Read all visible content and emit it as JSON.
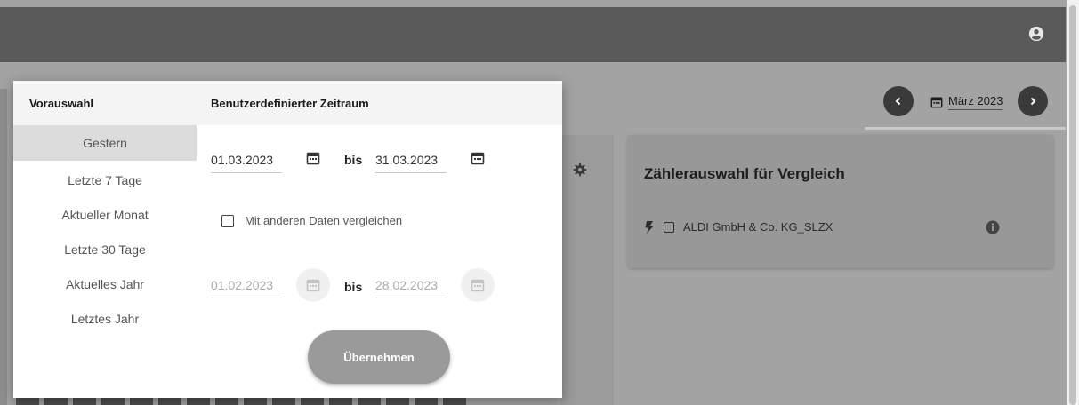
{
  "topbar": {
    "user_icon": "account-circle-icon"
  },
  "navigation": {
    "prev_icon": "chevron-left-icon",
    "next_icon": "chevron-right-icon",
    "month_label": "März 2023"
  },
  "meter_card": {
    "title": "Zählerauswahl für Vergleich",
    "items": [
      {
        "label": "ALDI GmbH & Co. KG_SLZX",
        "icon": "bolt-icon"
      }
    ]
  },
  "popup": {
    "presets_header": "Vorauswahl",
    "custom_header": "Benutzerdefinierter Zeitraum",
    "presets": [
      {
        "label": "Gestern",
        "active": true
      },
      {
        "label": "Letzte 7 Tage",
        "active": false
      },
      {
        "label": "Aktueller Monat",
        "active": false
      },
      {
        "label": "Letzte 30 Tage",
        "active": false
      },
      {
        "label": "Aktuelles Jahr",
        "active": false
      },
      {
        "label": "Letztes Jahr",
        "active": false
      }
    ],
    "range": {
      "from": "01.03.2023",
      "to": "31.03.2023",
      "separator": "bis"
    },
    "compare_label": "Mit anderen Daten vergleichen",
    "compare_checked": false,
    "compare_range": {
      "from": "01.02.2023",
      "to": "28.02.2023",
      "separator": "bis"
    },
    "apply_label": "Übernehmen"
  },
  "colors": {
    "topbar": "#5a5a5a",
    "overlay": "#a3a3a3",
    "active_preset": "#dcdcdc",
    "apply_button": "#9a9a9a"
  }
}
